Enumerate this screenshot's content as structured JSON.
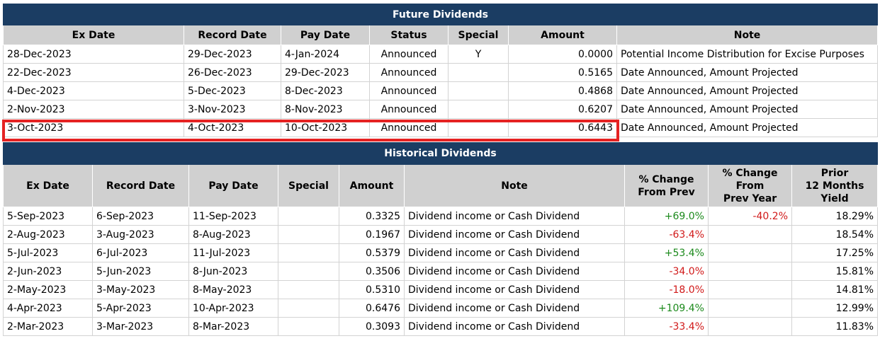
{
  "future": {
    "title": "Future Dividends",
    "columns": [
      "Ex Date",
      "Record Date",
      "Pay Date",
      "Status",
      "Special",
      "Amount",
      "Note"
    ],
    "rows": [
      {
        "ex": "28-Dec-2023",
        "record": "29-Dec-2023",
        "pay": "4-Jan-2024",
        "status": "Announced",
        "special": "Y",
        "amount": "0.0000",
        "note": "Potential Income Distribution for Excise Purposes"
      },
      {
        "ex": "22-Dec-2023",
        "record": "26-Dec-2023",
        "pay": "29-Dec-2023",
        "status": "Announced",
        "special": "",
        "amount": "0.5165",
        "note": "Date Announced, Amount Projected"
      },
      {
        "ex": "4-Dec-2023",
        "record": "5-Dec-2023",
        "pay": "8-Dec-2023",
        "status": "Announced",
        "special": "",
        "amount": "0.4868",
        "note": "Date Announced, Amount Projected"
      },
      {
        "ex": "2-Nov-2023",
        "record": "3-Nov-2023",
        "pay": "8-Nov-2023",
        "status": "Announced",
        "special": "",
        "amount": "0.6207",
        "note": "Date Announced, Amount Projected"
      },
      {
        "ex": "3-Oct-2023",
        "record": "4-Oct-2023",
        "pay": "10-Oct-2023",
        "status": "Announced",
        "special": "",
        "amount": "0.6443",
        "note": "Date Announced, Amount Projected"
      }
    ]
  },
  "historical": {
    "title": "Historical Dividends",
    "columns": {
      "ex": "Ex Date",
      "record": "Record Date",
      "pay": "Pay Date",
      "special": "Special",
      "amount": "Amount",
      "note": "Note",
      "chg_prev": [
        "% Change",
        "From Prev"
      ],
      "chg_year": [
        "% Change",
        "From",
        "Prev Year"
      ],
      "yield": [
        "Prior",
        "12 Months",
        "Yield"
      ]
    },
    "rows": [
      {
        "ex": "5-Sep-2023",
        "record": "6-Sep-2023",
        "pay": "11-Sep-2023",
        "special": "",
        "amount": "0.3325",
        "note": "Dividend income or Cash Dividend",
        "chg_prev": "+69.0%",
        "chg_year": "-40.2%",
        "yield": "18.29%"
      },
      {
        "ex": "2-Aug-2023",
        "record": "3-Aug-2023",
        "pay": "8-Aug-2023",
        "special": "",
        "amount": "0.1967",
        "note": "Dividend income or Cash Dividend",
        "chg_prev": "-63.4%",
        "chg_year": "",
        "yield": "18.54%"
      },
      {
        "ex": "5-Jul-2023",
        "record": "6-Jul-2023",
        "pay": "11-Jul-2023",
        "special": "",
        "amount": "0.5379",
        "note": "Dividend income or Cash Dividend",
        "chg_prev": "+53.4%",
        "chg_year": "",
        "yield": "17.25%"
      },
      {
        "ex": "2-Jun-2023",
        "record": "5-Jun-2023",
        "pay": "8-Jun-2023",
        "special": "",
        "amount": "0.3506",
        "note": "Dividend income or Cash Dividend",
        "chg_prev": "-34.0%",
        "chg_year": "",
        "yield": "15.81%"
      },
      {
        "ex": "2-May-2023",
        "record": "3-May-2023",
        "pay": "8-May-2023",
        "special": "",
        "amount": "0.5310",
        "note": "Dividend income or Cash Dividend",
        "chg_prev": "-18.0%",
        "chg_year": "",
        "yield": "14.81%"
      },
      {
        "ex": "4-Apr-2023",
        "record": "5-Apr-2023",
        "pay": "10-Apr-2023",
        "special": "",
        "amount": "0.6476",
        "note": "Dividend income or Cash Dividend",
        "chg_prev": "+109.4%",
        "chg_year": "",
        "yield": "12.99%"
      },
      {
        "ex": "2-Mar-2023",
        "record": "3-Mar-2023",
        "pay": "8-Mar-2023",
        "special": "",
        "amount": "0.3093",
        "note": "Dividend income or Cash Dividend",
        "chg_prev": "-33.4%",
        "chg_year": "",
        "yield": "11.83%"
      }
    ]
  },
  "colors": {
    "banner": "#1b3d63",
    "header_bg": "#d0d0d0",
    "positive": "#1c8a1c",
    "negative": "#d11919",
    "highlight": "#e52222"
  }
}
